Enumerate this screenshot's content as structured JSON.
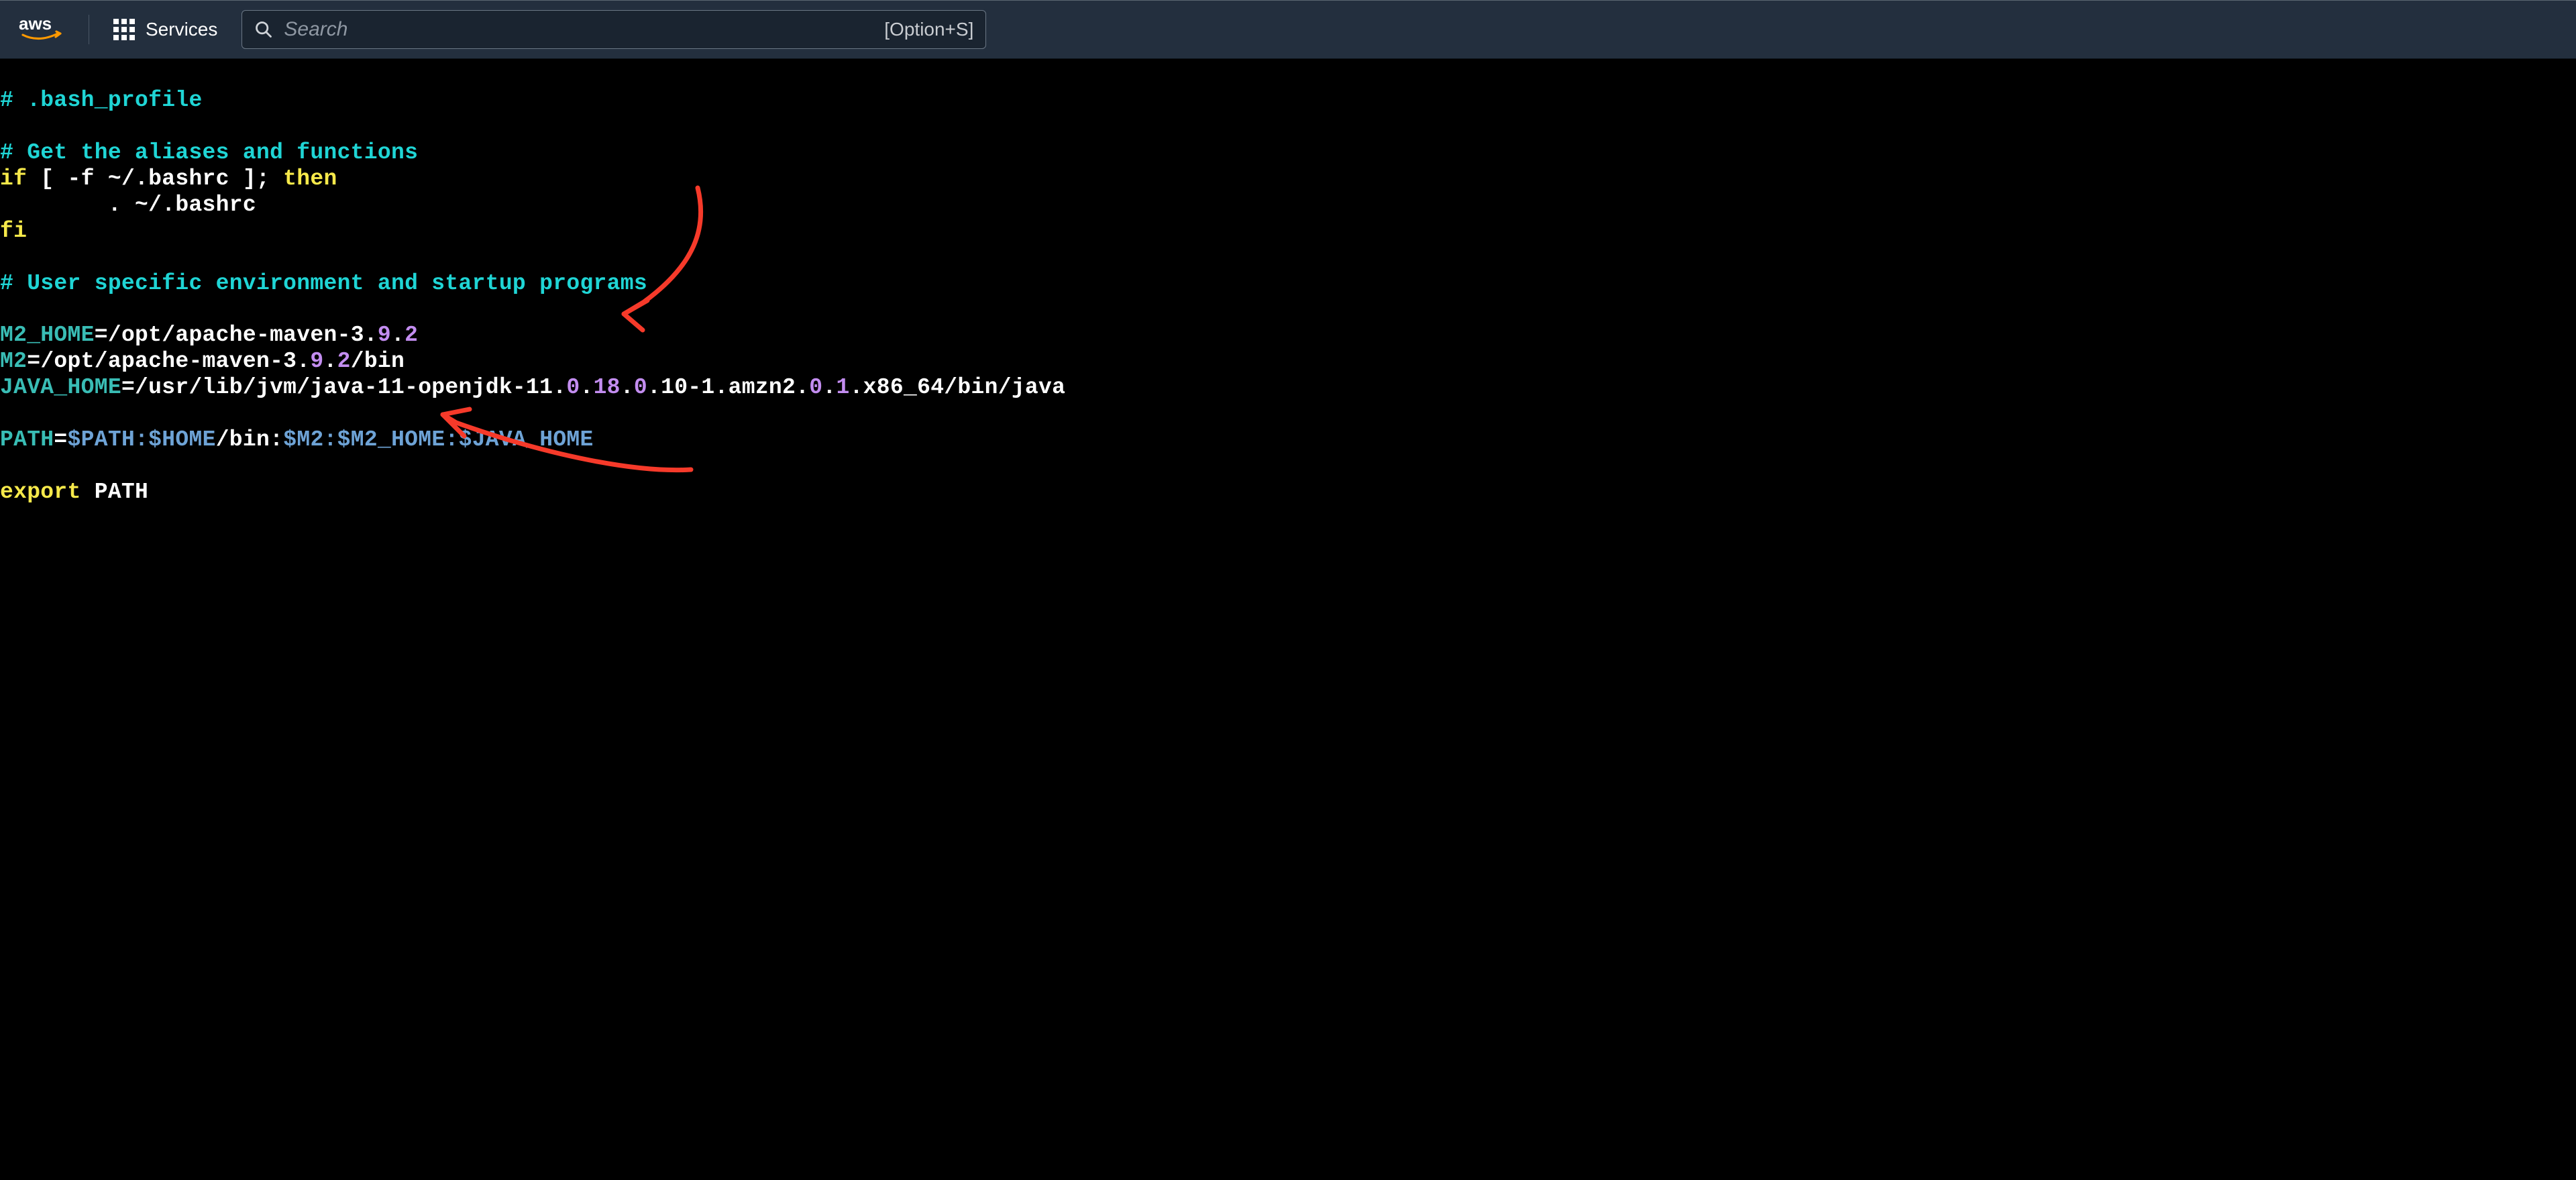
{
  "nav": {
    "services_label": "Services",
    "search_placeholder": "Search",
    "shortcut_hint": "[Option+S]"
  },
  "file": {
    "l1_comment": "# .bash_profile",
    "l2_blank": "",
    "l3_comment": "# Get the aliases and functions",
    "l4_if": "if",
    "l4_cond": " [ -f ~/.bashrc ]; ",
    "l4_then": "then",
    "l5_body": "        . ~/.bashrc",
    "l6_fi": "fi",
    "l7_blank": "",
    "l8_comment": "# User specific environment and startup programs",
    "l9_blank": "",
    "l10_var": "M2_HOME",
    "l10_eq": "=/opt/apache-maven-3.",
    "l10_n1": "9",
    "l10_mid": ".",
    "l10_n2": "2",
    "l11_var": "M2",
    "l11_eq": "=/opt/apache-maven-3.",
    "l11_n1": "9",
    "l11_mid": ".",
    "l11_n2": "2",
    "l11_tail": "/bin",
    "l12_var": "JAVA_HOME",
    "l12_a": "=/usr/lib/jvm/java-11-openjdk-11.",
    "l12_n1": "0",
    "l12_b": ".",
    "l12_n2": "18",
    "l12_c": ".",
    "l12_n3": "0",
    "l12_d": ".10-1.amzn2.",
    "l12_n4": "0",
    "l12_e": ".",
    "l12_n5": "1",
    "l12_f": ".x86_64/bin/java",
    "l13_blank": "",
    "l14_var": "PATH",
    "l14_eq": "=",
    "l14_p1": "$PATH",
    "l14_s1": ":",
    "l14_p2": "$HOME",
    "l14_mid": "/bin:",
    "l14_p3": "$M2",
    "l14_s2": ":",
    "l14_p4": "$M2_HOME",
    "l14_s3": ":",
    "l14_p5": "$JAVA_HOME",
    "l15_blank": "",
    "l16_export": "export",
    "l16_path": " PATH"
  }
}
